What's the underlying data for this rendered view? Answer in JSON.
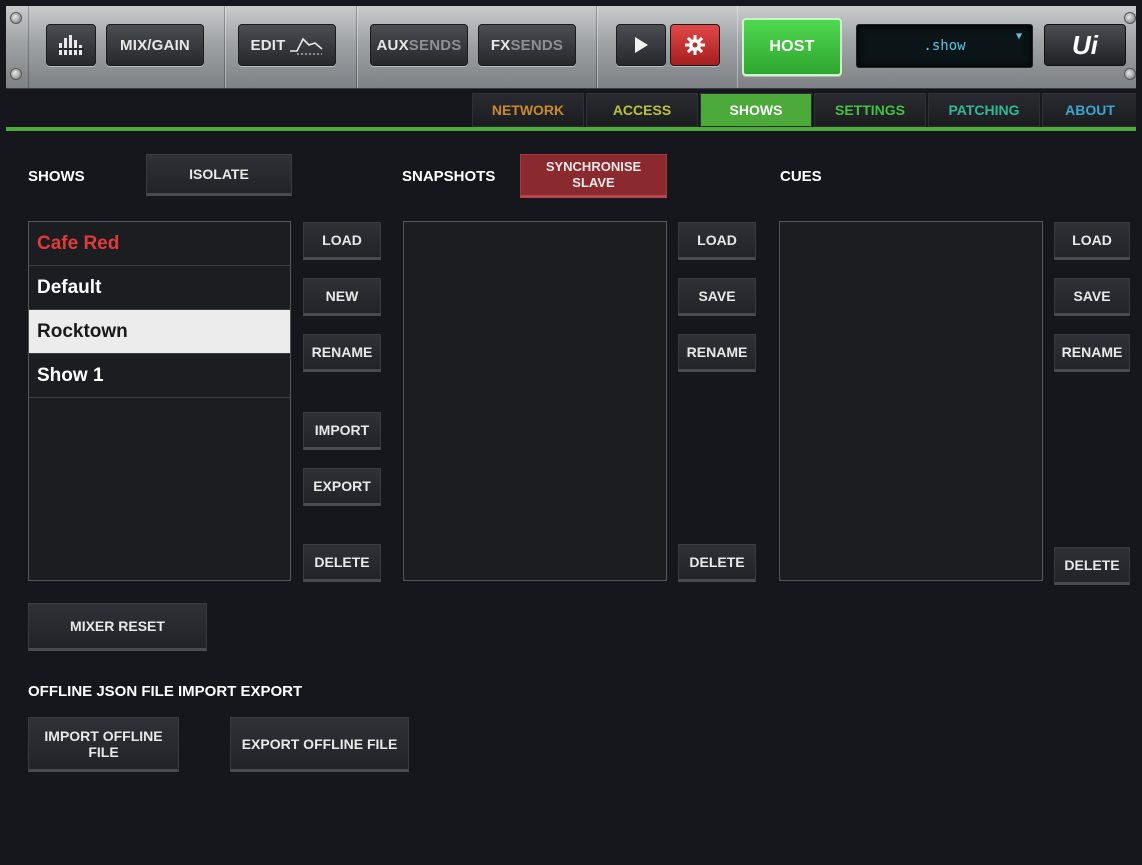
{
  "topbar": {
    "mix_gain_label": "MIX/GAIN",
    "edit_label": "EDIT",
    "aux_label": "AUX",
    "aux_sub": "SENDS",
    "fx_label": "FX",
    "fx_sub": "SENDS",
    "host_label": "HOST",
    "display_text": ".show",
    "logo_text": "Ui",
    "icons": [
      "meters-icon",
      "eq-curve-icon",
      "play-icon",
      "gear-icon",
      "dropdown-caret-icon"
    ],
    "colors": {
      "host": "#3fbf3f",
      "gear": "#d23434",
      "display_text": "#59c8e8"
    }
  },
  "tabs": [
    {
      "label": "NETWORK",
      "color": "#c98a2e"
    },
    {
      "label": "ACCESS",
      "color": "#b9c23a"
    },
    {
      "label": "SHOWS",
      "color": "#ffffff"
    },
    {
      "label": "SETTINGS",
      "color": "#44c045"
    },
    {
      "label": "PATCHING",
      "color": "#2fb898"
    },
    {
      "label": "ABOUT",
      "color": "#3aa6cf"
    }
  ],
  "active_tab": "SHOWS",
  "shows": {
    "title": "SHOWS",
    "isolate_label": "ISOLATE",
    "items": [
      {
        "name": "Cafe Red",
        "state": "loaded"
      },
      {
        "name": "Default",
        "state": "normal"
      },
      {
        "name": "Rocktown",
        "state": "selected"
      },
      {
        "name": "Show 1",
        "state": "normal"
      }
    ],
    "buttons": {
      "load": "LOAD",
      "new": "NEW",
      "rename": "RENAME",
      "import": "IMPORT",
      "export": "EXPORT",
      "delete": "DELETE"
    }
  },
  "snapshots": {
    "title": "SNAPSHOTS",
    "sync_line1": "SYNCHRONISE",
    "sync_line2": "SLAVE",
    "buttons": {
      "load": "LOAD",
      "save": "SAVE",
      "rename": "RENAME",
      "delete": "DELETE"
    }
  },
  "cues": {
    "title": "CUES",
    "buttons": {
      "load": "LOAD",
      "save": "SAVE",
      "rename": "RENAME",
      "delete": "DELETE"
    }
  },
  "mixer_reset_label": "MIXER RESET",
  "offline": {
    "title": "OFFLINE JSON FILE IMPORT EXPORT",
    "import_label": "IMPORT OFFLINE FILE",
    "export_label": "EXPORT OFFLINE FILE"
  }
}
